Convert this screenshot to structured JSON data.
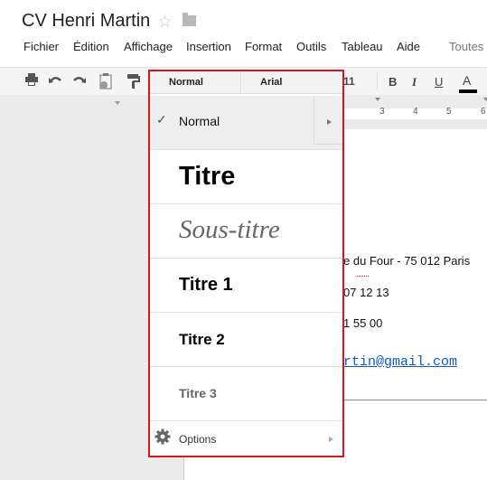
{
  "document": {
    "title": "CV Henri Martin",
    "star_icon": "star-icon",
    "folder_icon": "folder-icon"
  },
  "menubar": {
    "items": [
      "Fichier",
      "Édition",
      "Affichage",
      "Insertion",
      "Format",
      "Outils",
      "Tableau",
      "Aide"
    ],
    "trailing": "Toutes"
  },
  "toolbar": {
    "icons": [
      "print-icon",
      "undo-icon",
      "redo-icon",
      "paste-format-icon",
      "paint-format-icon"
    ],
    "style_select": "Normal",
    "font_select": "Arial",
    "font_size": "11",
    "bold": "B",
    "italic": "I",
    "underline": "U",
    "text_color": "A",
    "text_color_value": "#000000"
  },
  "ruler": {
    "numbers": [
      "3",
      "4",
      "5",
      "6"
    ]
  },
  "style_menu": {
    "selected": "Normal",
    "items": [
      {
        "label": "Normal",
        "checked": true
      },
      {
        "label": "Titre"
      },
      {
        "label": "Sous-titre"
      },
      {
        "label": "Titre 1"
      },
      {
        "label": "Titre 2"
      },
      {
        "label": "Titre 3"
      }
    ],
    "options_label": "Options",
    "highlight_color": "#d8161b"
  },
  "document_body": {
    "address": "e du Four -  75 012 Paris",
    "phone1": "07 12 13",
    "phone2": "1 55 00",
    "email": "rtin@gmail.com"
  }
}
